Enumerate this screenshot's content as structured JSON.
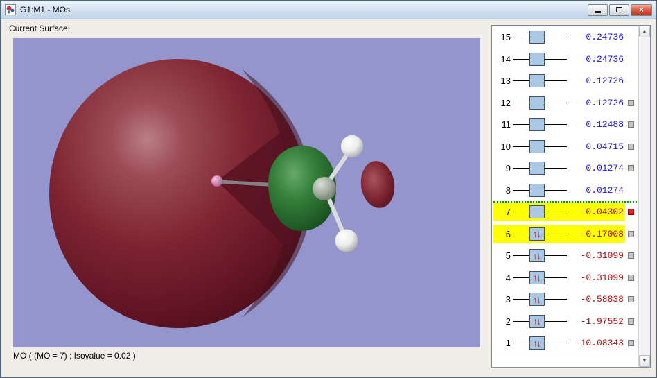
{
  "window": {
    "title": "G1:M1 - MOs",
    "controls": {
      "minimize": "minimize",
      "maximize": "maximize",
      "close": "close"
    }
  },
  "main": {
    "current_surface_label": "Current Surface:",
    "viewport_caption": "MO ( (MO = 7) ; Isovalue = 0.02 )"
  },
  "mo_list": {
    "spin_arrows": "↑↓",
    "rows": [
      {
        "index": "15",
        "energy": "0.24736",
        "occupied": false,
        "highlighted": false,
        "checkbox": "none"
      },
      {
        "index": "14",
        "energy": "0.24736",
        "occupied": false,
        "highlighted": false,
        "checkbox": "none"
      },
      {
        "index": "13",
        "energy": "0.12726",
        "occupied": false,
        "highlighted": false,
        "checkbox": "none"
      },
      {
        "index": "12",
        "energy": "0.12726",
        "occupied": false,
        "highlighted": false,
        "checkbox": "gray"
      },
      {
        "index": "11",
        "energy": "0.12488",
        "occupied": false,
        "highlighted": false,
        "checkbox": "gray"
      },
      {
        "index": "10",
        "energy": "0.04715",
        "occupied": false,
        "highlighted": false,
        "checkbox": "gray"
      },
      {
        "index": "9",
        "energy": "0.01274",
        "occupied": false,
        "highlighted": false,
        "checkbox": "gray"
      },
      {
        "index": "8",
        "energy": "0.01274",
        "occupied": false,
        "highlighted": false,
        "checkbox": "none"
      },
      {
        "index": "7",
        "energy": "-0.04302",
        "occupied": false,
        "highlighted": true,
        "checkbox": "red"
      },
      {
        "index": "6",
        "energy": "-0.17008",
        "occupied": true,
        "highlighted": true,
        "checkbox": "gray"
      },
      {
        "index": "5",
        "energy": "-0.31099",
        "occupied": true,
        "highlighted": false,
        "checkbox": "gray"
      },
      {
        "index": "4",
        "energy": "-0.31099",
        "occupied": true,
        "highlighted": false,
        "checkbox": "gray"
      },
      {
        "index": "3",
        "energy": "-0.58838",
        "occupied": true,
        "highlighted": false,
        "checkbox": "gray"
      },
      {
        "index": "2",
        "energy": "-1.97552",
        "occupied": true,
        "highlighted": false,
        "checkbox": "gray"
      },
      {
        "index": "1",
        "energy": "-10.08343",
        "occupied": true,
        "highlighted": false,
        "checkbox": "gray"
      }
    ]
  },
  "scrollbar": {
    "up_arrow": "▲",
    "down_arrow": "▼"
  },
  "colors": {
    "body_bg": "#f0ede8",
    "viewport_bg": "#9595ce",
    "positive_energy": "#1a1acd",
    "negative_energy": "#a01414",
    "highlight": "#ffff00",
    "orbital_box": "#a9c8e6",
    "separator_green": "#00a400",
    "selected_checkbox": "#e02222",
    "big_lobe": "#7e2433",
    "green_lobe": "#35803b"
  }
}
